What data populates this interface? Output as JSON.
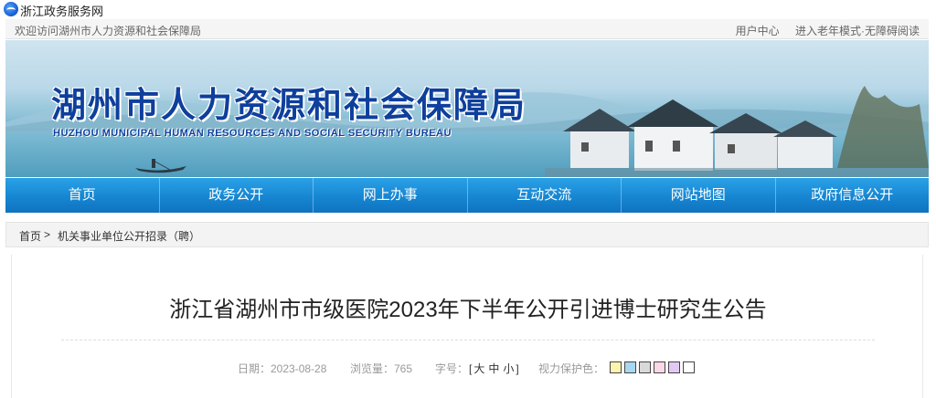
{
  "topbar": {
    "site_name": "浙江政务服务网",
    "logo_icon": "zhejiang-gov-logo-icon"
  },
  "welcome": {
    "text": "欢迎访问湖州市人力资源和社会保障局",
    "user_center": "用户中心",
    "elder_mode": "进入老年模式",
    "barrier_free": "无障碍阅读",
    "separator": "·"
  },
  "banner": {
    "title_cn": "湖州市人力资源和社会保障局",
    "title_en": "HUZHOU MUNICIPAL HUMAN RESOURCES AND SOCIAL SECURITY BUREAU"
  },
  "nav": {
    "items": [
      {
        "label": "首页"
      },
      {
        "label": "政务公开"
      },
      {
        "label": "网上办事"
      },
      {
        "label": "互动交流"
      },
      {
        "label": "网站地图"
      },
      {
        "label": "政府信息公开"
      }
    ]
  },
  "breadcrumb": {
    "home": "首页",
    "separator": ">",
    "current": "机关事业单位公开招录（聘）"
  },
  "article": {
    "title": "浙江省湖州市市级医院2023年下半年公开引进博士研究生公告",
    "date_label": "日期：2023-08-28",
    "views_label": "浏览量：765",
    "font_label": "字号：",
    "font_open": "[",
    "font_large": "大",
    "font_medium": "中",
    "font_small": "小",
    "font_close": "]",
    "eye_label": "视力保护色：",
    "eye_colors": [
      "#fcf3b0",
      "#a8d8f0",
      "#d9d9d9",
      "#f9d9e6",
      "#e2c9f4",
      "#ffffff"
    ]
  }
}
